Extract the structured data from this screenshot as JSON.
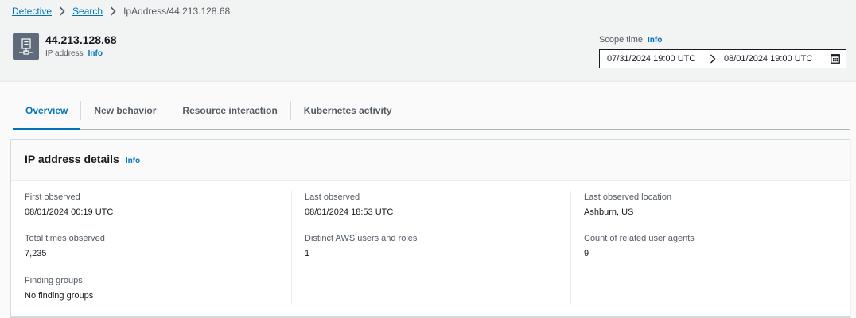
{
  "breadcrumb": {
    "items": [
      "Detective",
      "Search"
    ],
    "current": "IpAddress/44.213.128.68"
  },
  "header": {
    "title": "44.213.128.68",
    "subtitle": "IP address",
    "info": "Info",
    "icon": "ip-address-icon"
  },
  "scope_time": {
    "label": "Scope time",
    "info": "Info",
    "start": "07/31/2024 19:00 UTC",
    "end": "08/01/2024 19:00 UTC"
  },
  "tabs": [
    "Overview",
    "New behavior",
    "Resource interaction",
    "Kubernetes activity"
  ],
  "panel": {
    "title": "IP address details",
    "info": "Info",
    "fields": {
      "first_observed": {
        "label": "First observed",
        "value": "08/01/2024 00:19 UTC"
      },
      "last_observed": {
        "label": "Last observed",
        "value": "08/01/2024 18:53 UTC"
      },
      "last_location": {
        "label": "Last observed location",
        "value": "Ashburn, US"
      },
      "total_times": {
        "label": "Total times observed",
        "value": "7,235"
      },
      "distinct_users": {
        "label": "Distinct AWS users and roles",
        "value": "1"
      },
      "user_agents": {
        "label": "Count of related user agents",
        "value": "9"
      },
      "finding_groups": {
        "label": "Finding groups",
        "value": "No finding groups"
      }
    }
  },
  "colors": {
    "link": "#0073bb",
    "text": "#16191f",
    "muted": "#545b64",
    "icon_bg": "#5f6b7a",
    "page_bg": "#f2f3f3"
  }
}
